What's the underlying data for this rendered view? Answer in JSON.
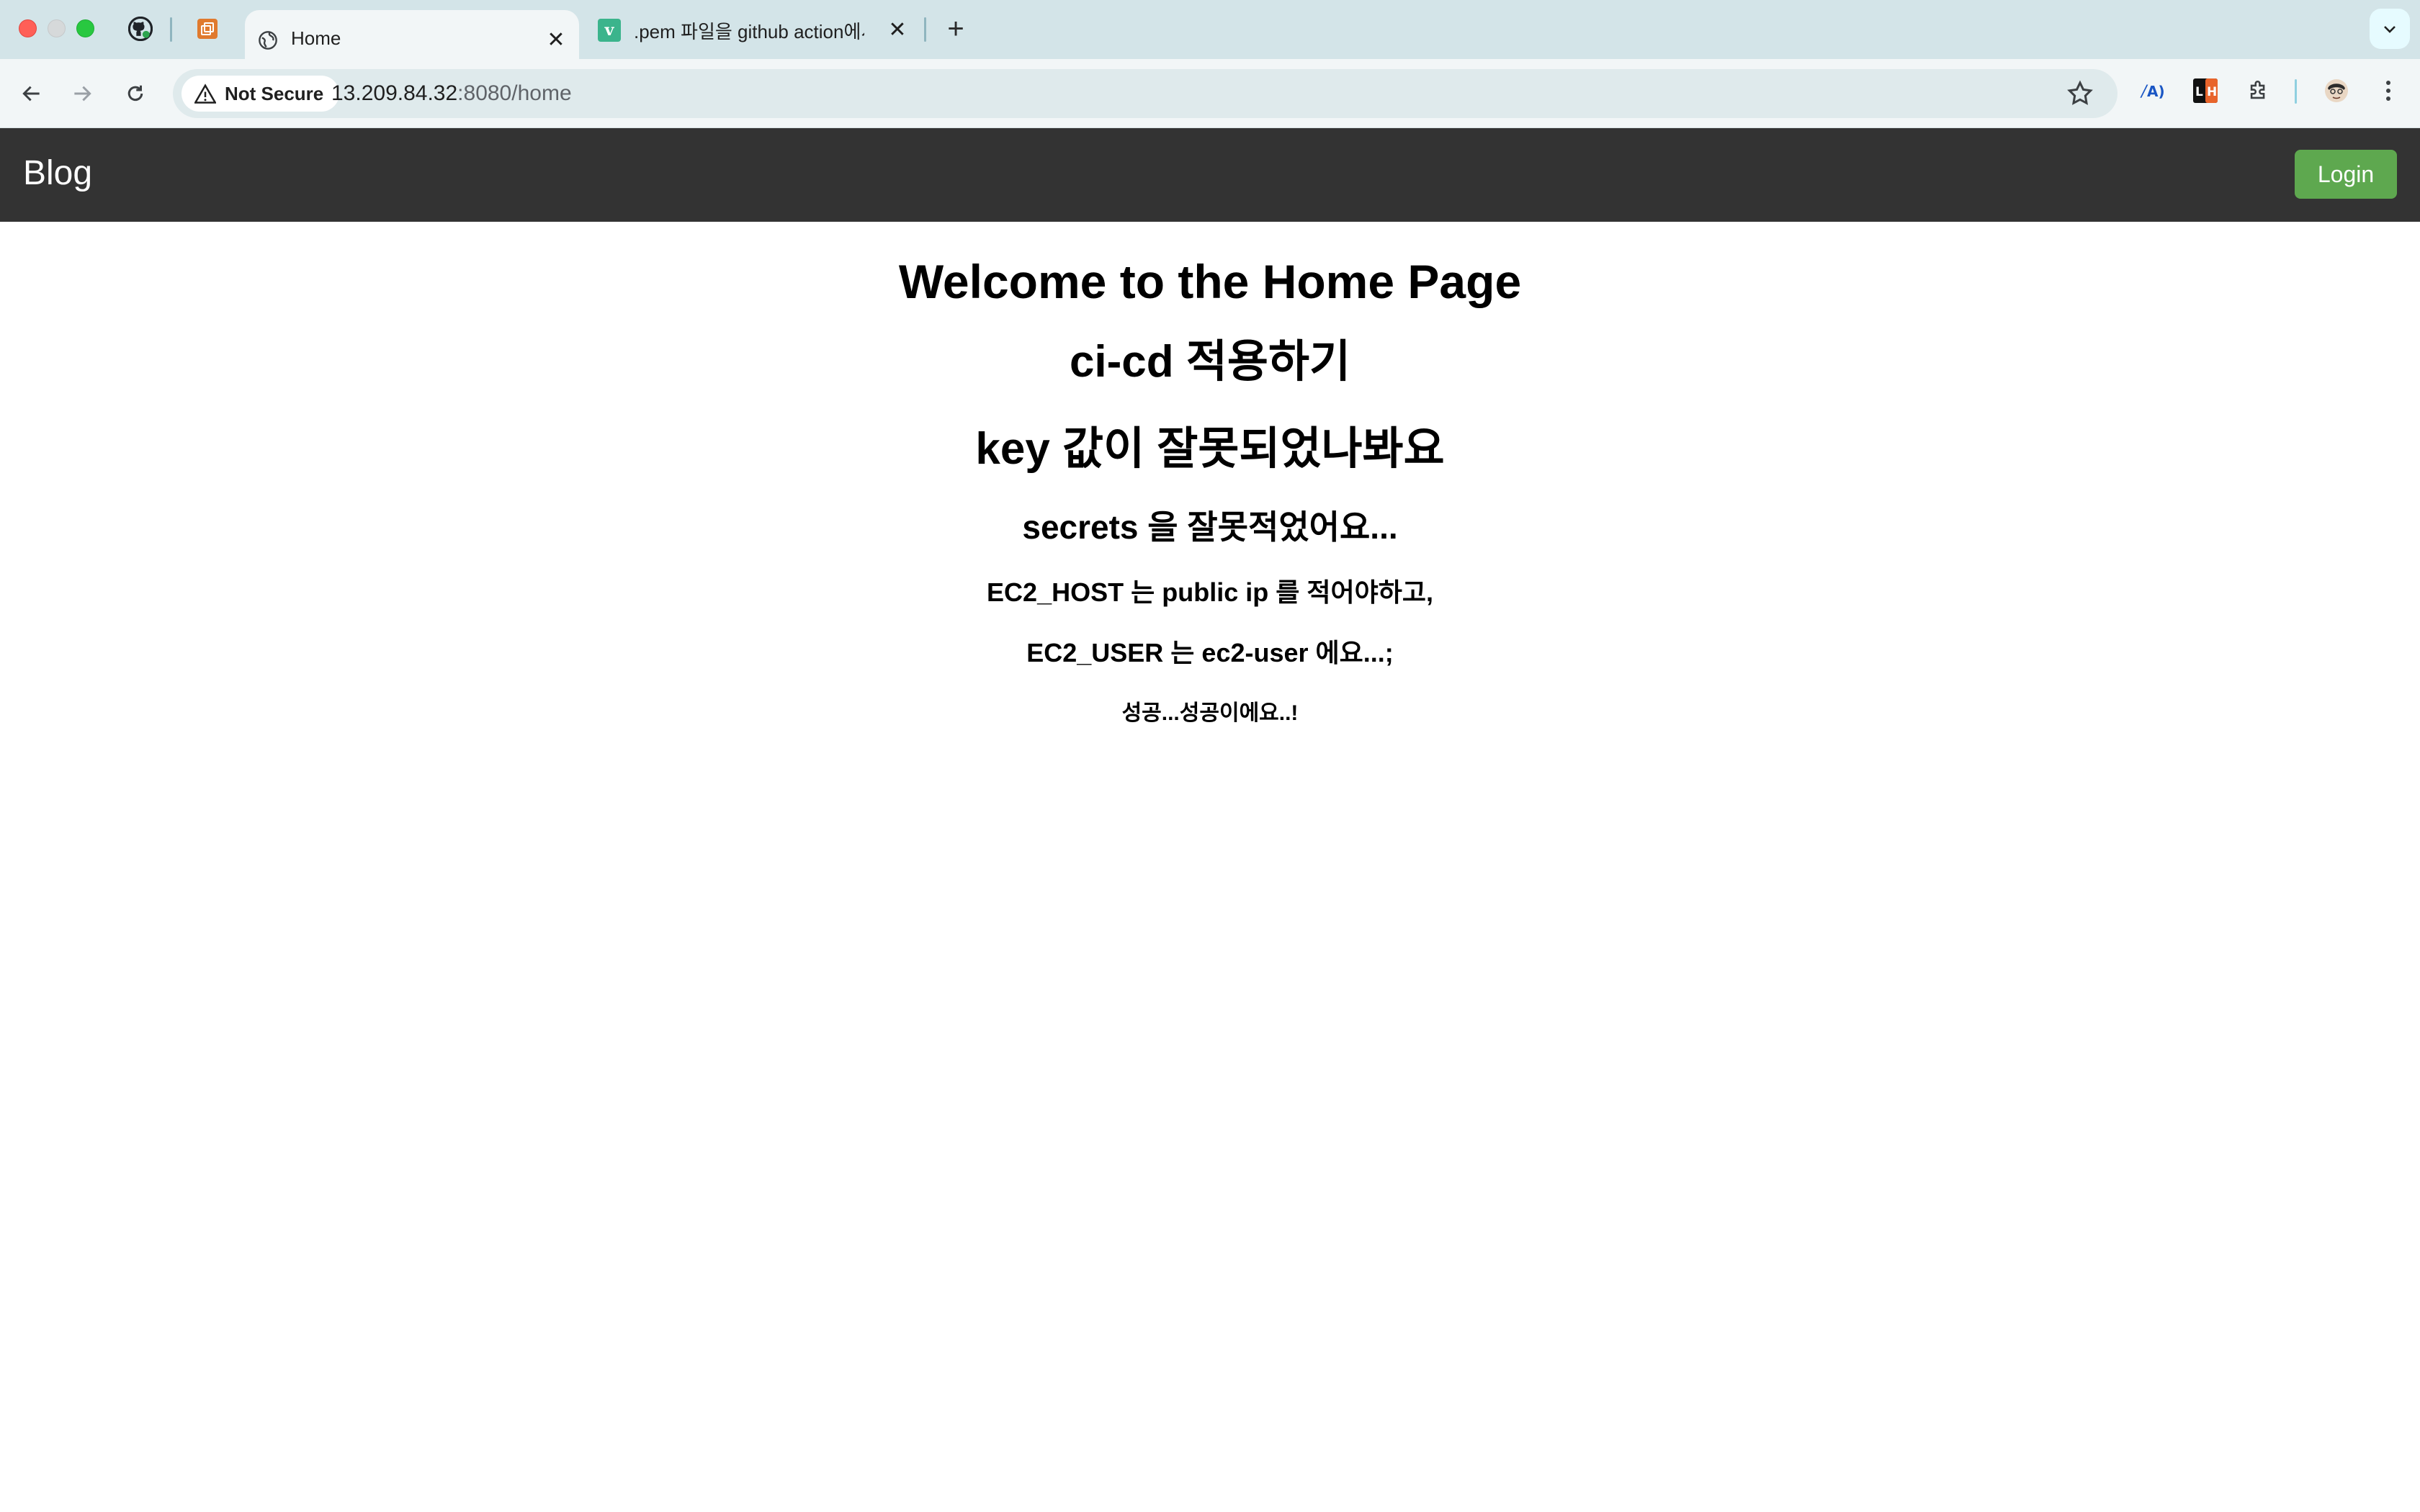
{
  "browser": {
    "tabs": [
      {
        "title": "Home",
        "active": true
      },
      {
        "title": ".pem 파일을 github action에서",
        "active": false
      }
    ],
    "address_bar": {
      "security_label": "Not Secure",
      "url_host": "13.209.84.32",
      "url_rest": ":8080/home"
    }
  },
  "navbar": {
    "brand": "Blog",
    "login_label": "Login"
  },
  "content": {
    "heading_1": "Welcome to the Home Page",
    "heading_2a": "ci-cd 적용하기",
    "heading_2b": "key 값이 잘못되었나봐요",
    "heading_3": "secrets 을 잘못적었어요...",
    "heading_4a": "EC2_HOST 는 public ip 를 적어야하고,",
    "heading_4b": "EC2_USER 는 ec2-user 에요...;",
    "heading_5": "성공...성공이에요..!"
  },
  "colors": {
    "navbar_bg": "#333333",
    "login_button": "#5ea84f",
    "tabstrip_bg": "#d3e4e8"
  },
  "icons": [
    "github-icon",
    "orange-app-icon",
    "globe-icon",
    "v-favicon-icon",
    "warning-icon",
    "star-icon",
    "profile-avatar"
  ]
}
